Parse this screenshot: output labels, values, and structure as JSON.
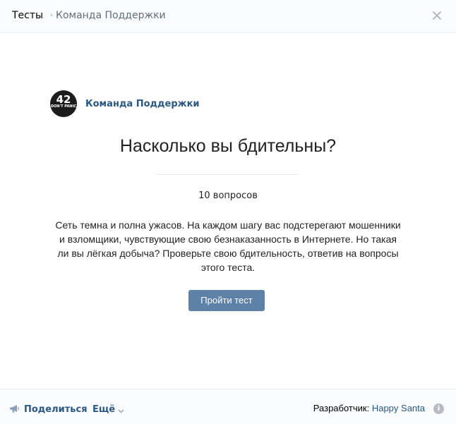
{
  "header": {
    "title": "Тесты",
    "separator": "›",
    "breadcrumb": "Команда Поддержки"
  },
  "author": {
    "avatar_number": "42",
    "avatar_text": "DON'T PANIC",
    "name": "Команда Поддержки"
  },
  "quiz": {
    "title": "Насколько вы бдительны?",
    "question_count": "10 вопросов",
    "description": "Сеть темна и полна ужасов. На каждом шагу вас подстерегают мошенники и взломщики, чувствующие свою безнаказанность в Интернете. Но такая ли вы лёгкая добыча? Проверьте свою бдительность, ответив на вопросы этого теста.",
    "start_label": "Пройти тест"
  },
  "footer": {
    "share_label": "Поделиться",
    "more_label": "Ещё",
    "developer_label": "Разработчик:",
    "developer_name": "Happy Santa",
    "info_icon": "i"
  },
  "colors": {
    "accent": "#2a5885",
    "button": "#5e81a8",
    "header_bg": "#fafbfc",
    "border": "#e7e8ec"
  },
  "icons": {
    "close": "close-icon",
    "share": "megaphone-icon",
    "more": "chevron-down-icon",
    "info": "info-icon"
  }
}
